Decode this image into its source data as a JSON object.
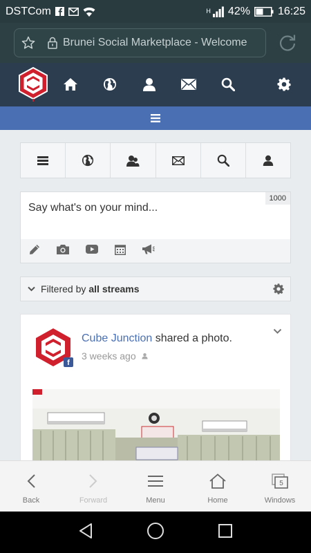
{
  "status_bar": {
    "carrier": "DSTCom",
    "network": "H",
    "battery": "42%",
    "time": "16:25"
  },
  "browser": {
    "url_title": "Brunei Social Marketplace - Welcome"
  },
  "composer": {
    "placeholder": "Say what's on your mind...",
    "counter": "1000"
  },
  "filter": {
    "prefix": "Filtered by",
    "value": "all streams"
  },
  "post": {
    "author": "Cube Junction",
    "action": "shared a photo.",
    "time": "3 weeks ago"
  },
  "bottom_bar": {
    "back": "Back",
    "forward": "Forward",
    "menu": "Menu",
    "home": "Home",
    "windows": "Windows",
    "windows_count": "5"
  },
  "colors": {
    "header": "#2c3d50",
    "menu_strip": "#4a6fb2",
    "link": "#4a6fb2",
    "logo_red": "#d0202e"
  }
}
